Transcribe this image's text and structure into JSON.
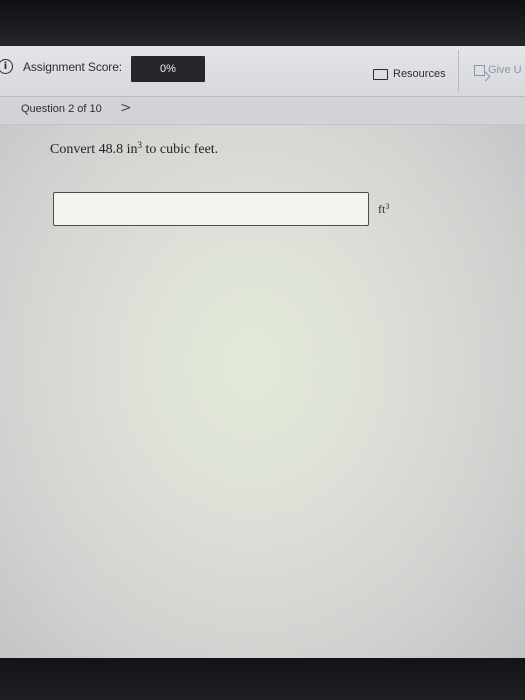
{
  "header": {
    "score_label": "Assignment Score:",
    "score_value": "0%",
    "resources_label": "Resources",
    "give_label": "Give U"
  },
  "question_nav": {
    "label": "Question 2 of 10",
    "next_glyph": ">"
  },
  "question": {
    "text_before": "Convert 48.8 in",
    "exponent": "3",
    "text_after": " to cubic feet."
  },
  "answer": {
    "value": "",
    "unit_base": "ft",
    "unit_exponent": "3"
  },
  "icons": {
    "info": "info-icon",
    "resources": "folder-icon",
    "give": "give-up-icon",
    "next": "chevron-right-icon"
  }
}
